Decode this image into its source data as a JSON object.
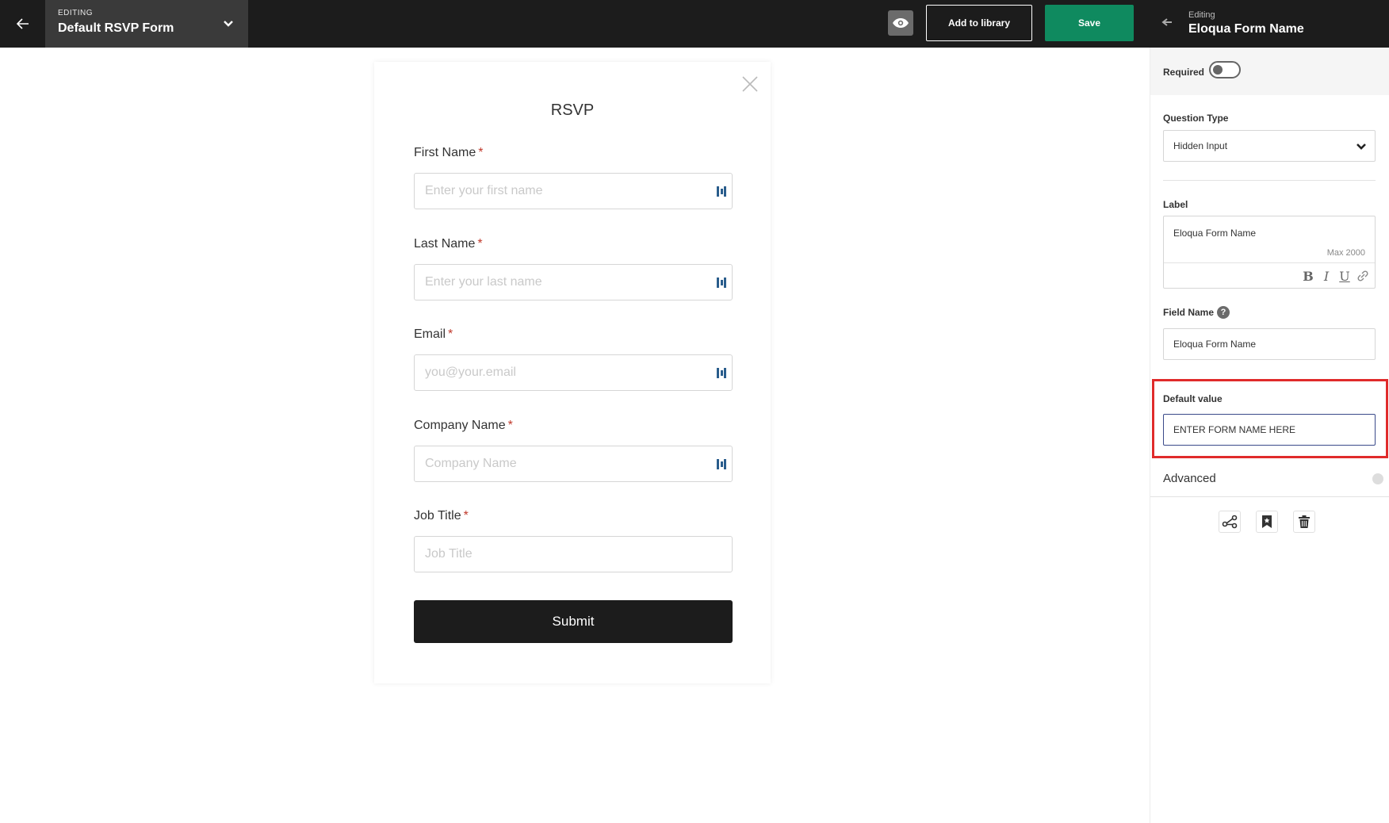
{
  "topbar": {
    "editing_eyebrow": "EDITING",
    "form_name": "Default RSVP Form",
    "add_library_label": "Add to library",
    "save_label": "Save",
    "save_color": "#0f8a5f"
  },
  "panel_header": {
    "eyebrow": "Editing",
    "title": "Eloqua Form Name"
  },
  "form": {
    "title": "RSVP",
    "fields": [
      {
        "label": "First Name",
        "required": "*",
        "placeholder": "Enter your first name"
      },
      {
        "label": "Last Name",
        "required": "*",
        "placeholder": "Enter your last name"
      },
      {
        "label": "Email",
        "required": "*",
        "placeholder": "you@your.email"
      },
      {
        "label": "Company Name",
        "required": "*",
        "placeholder": "Company Name"
      },
      {
        "label": "Job Title",
        "required": "*",
        "placeholder": "Job Title"
      }
    ],
    "submit_label": "Submit"
  },
  "side": {
    "required_label": "Required",
    "required_on": false,
    "question_type_label": "Question Type",
    "question_type_value": "Hidden Input",
    "label_label": "Label",
    "label_value": "Eloqua Form Name",
    "label_max": "Max 2000",
    "toolbar": {
      "bold": "B",
      "italic": "I",
      "underline": "U"
    },
    "field_name_label": "Field Name",
    "field_name_help": "?",
    "field_name_value": "Eloqua Form Name",
    "default_value_label": "Default value",
    "default_value_value": "ENTER FORM NAME HERE",
    "advanced_label": "Advanced",
    "highlight_color": "#e02b2b"
  },
  "icons": [
    "back-arrow-icon",
    "chevron-down-icon",
    "eye-icon",
    "close-icon",
    "autofill-icon",
    "link-icon",
    "logic-icon",
    "bookmark-star-icon",
    "trash-icon"
  ]
}
